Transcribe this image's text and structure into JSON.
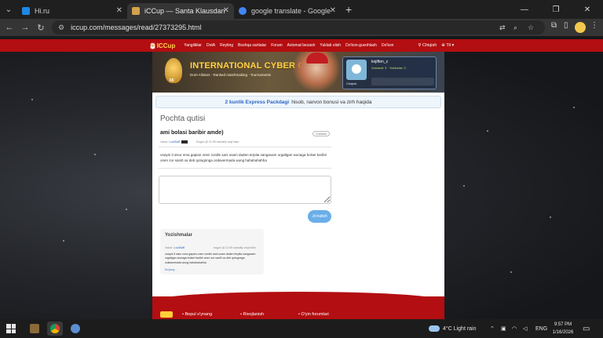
{
  "browser": {
    "tabs": [
      {
        "title": "Hi.ru",
        "active": false,
        "favicon_color": "#1e88e5"
      },
      {
        "title": "iCCup — Santa Klausdan kelga",
        "active": true,
        "favicon_color": "#d4a24a"
      },
      {
        "title": "google translate - Google Sear",
        "active": false,
        "favicon_color": "#4285f4"
      }
    ],
    "new_tab": "+",
    "url": "iccup.com/messages/read/27373295.html"
  },
  "site": {
    "logo": "ICCup",
    "nav": [
      "Yangiliklar",
      "DotA",
      "Reyting",
      "Boshqa xaritalar",
      "Forum",
      "Avtomat bezash",
      "Yuklab olish",
      "Do'kon-guvohlash",
      "Do'kon"
    ],
    "nav_right": [
      "Chiqish",
      "Til"
    ]
  },
  "banner": {
    "title": "INTERNATIONAL CYBER CUP",
    "subtitle": "DotA Allstars · Ranked matchmaking · Tournaments",
    "medal_level": "65"
  },
  "profile": {
    "username": "kojiften_z",
    "line": "Xursand: 3  ·  Yulduzlar: 0",
    "logout": "Chiqish"
  },
  "promo": {
    "highlight": "2 kunlik Express Packdagi",
    "text": "hisob, narvon bonusi va zirh haqida"
  },
  "mail": {
    "title": "Pochta qutisi",
    "subject": "ami bolasi baribir amde)",
    "delete_label": "O'chirish",
    "from_label": "Xabar:",
    "from_user": "Lxa35aR",
    "date": "Bugun @ 21:55 mahalliy vaqt bilan",
    "body": "onayni it sisur nma gapian onen zordle sani usam daden terpita sangavam orgaltgan wunaga bolsei baribir onen zor sani0 xa deb qotognnga ositavermada wung hahahahahha",
    "reply_placeholder": "",
    "send_label": "Jo'natish"
  },
  "conversation": {
    "title": "Yozishmalar",
    "from_label": "Xabar:",
    "user": "Lxa35aR",
    "date": "bugun @ 21:55 mahalliy vaqt bilan",
    "text": "onayni it sisur nma gapian onen zordle sani usam daden terpita sangavam orgaltgan wunaga bolsei baribir onen zor sani0 xa deb qotognnga ositavermada wung hahahahahha",
    "more": "Ko'proq..."
  },
  "footer": {
    "links": [
      "Bepul o'ynang",
      "Rivojlanish",
      "O'yin forumlari"
    ]
  },
  "taskbar": {
    "weather_temp": "4°C",
    "weather_text": "Light rain",
    "language": "ENG",
    "time": "9:57 PM",
    "date": "1/16/2026"
  }
}
